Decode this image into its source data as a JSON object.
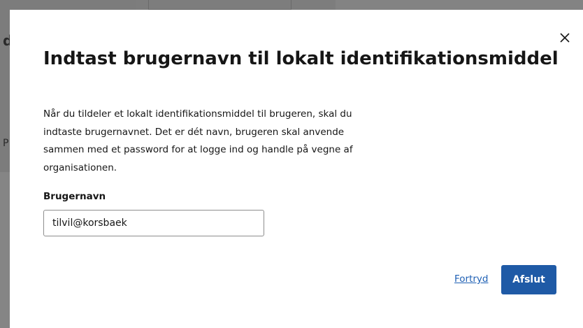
{
  "dialog": {
    "title": "Indtast brugernavn til lokalt identifikationsmiddel",
    "description": "Når du tildeler et lokalt identifikationsmiddel til brugeren, skal du indtaste brugernavnet. Det er dét navn, brugeren skal anvende sammen med et password for at logge ind og handle på vegne af organisationen.",
    "field_label": "Brugernavn",
    "username_value": "tilvil@korsbaek",
    "cancel_label": "Fortryd",
    "finish_label": "Afslut",
    "close_icon": "close-icon"
  },
  "background": {
    "fragment_1": "d",
    "fragment_2": "P"
  },
  "colors": {
    "primary_button": "#1f5aa6",
    "link": "#1d5fb4",
    "text": "#161616",
    "overlay": "#808080"
  }
}
